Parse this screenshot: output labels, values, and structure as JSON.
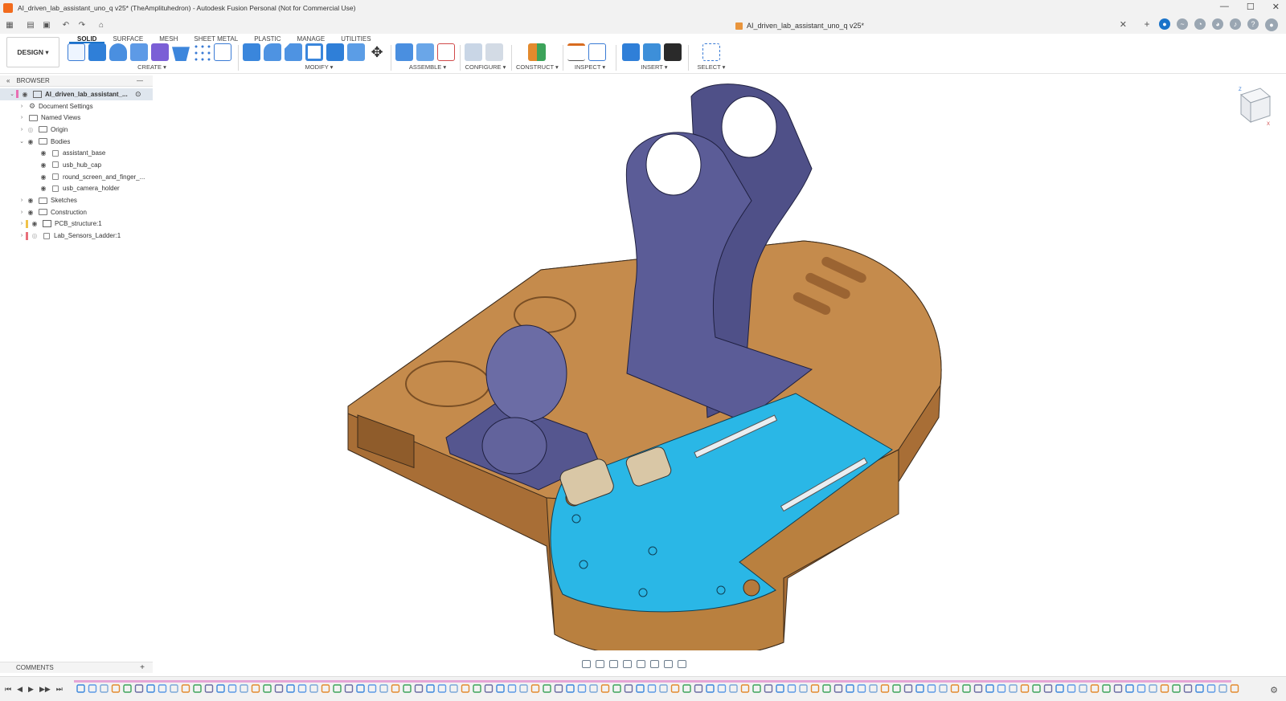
{
  "window": {
    "title": "AI_driven_lab_assistant_uno_q v25* (TheAmplituhedron) - Autodesk Fusion Personal (Not for Commercial Use)",
    "controls": [
      "—",
      "☐",
      "✕"
    ]
  },
  "tabbar": {
    "document_tab": "AI_driven_lab_assistant_uno_q v25*",
    "close": "✕"
  },
  "toolbar": {
    "workspace": "DESIGN ▾",
    "tabs": [
      "SOLID",
      "SURFACE",
      "MESH",
      "SHEET METAL",
      "PLASTIC",
      "MANAGE",
      "UTILITIES"
    ],
    "groups": {
      "create": "CREATE ▾",
      "modify": "MODIFY ▾",
      "assemble": "ASSEMBLE ▾",
      "configure": "CONFIGURE ▾",
      "construct": "CONSTRUCT ▾",
      "inspect": "INSPECT ▾",
      "insert": "INSERT ▾",
      "select": "SELECT ▾"
    }
  },
  "browser": {
    "title": "BROWSER",
    "root": "AI_driven_lab_assistant_...",
    "items": {
      "document_settings": "Document Settings",
      "named_views": "Named Views",
      "origin": "Origin",
      "bodies": "Bodies",
      "body_1": "assistant_base",
      "body_2": "usb_hub_cap",
      "body_3": "round_screen_and_finger_...",
      "body_4": "usb_camera_holder",
      "sketches": "Sketches",
      "construction": "Construction",
      "pcb": "PCB_structure:1",
      "lab_sensors": "Lab_Sensors_Ladder:1"
    }
  },
  "comments": {
    "title": "COMMENTS",
    "plus": "+"
  },
  "colors": {
    "base_brown": "#b67a3e",
    "base_top": "#c58b4c",
    "holder_purple": "#5b5c97",
    "pcb_blue": "#2ab7e6",
    "accent": "#1a73c9"
  },
  "timeline": {
    "controls": [
      "⏮",
      "◀",
      "▶",
      "▶▶",
      "⏭"
    ]
  }
}
